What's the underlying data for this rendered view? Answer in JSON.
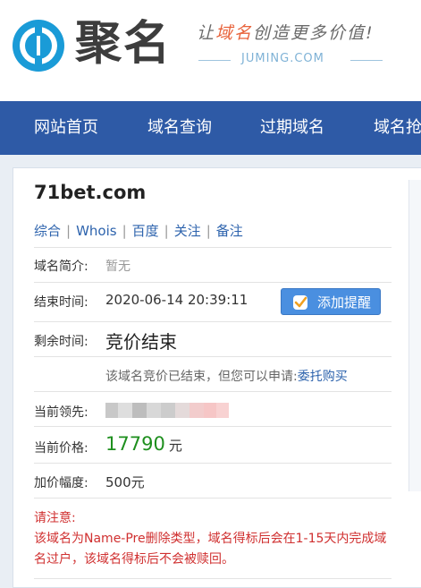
{
  "header": {
    "logo_text": "聚名",
    "slogan_prefix": "让",
    "slogan_highlight": "域名",
    "slogan_suffix": "创造更多价值!",
    "brand_domain": "JUMING.COM"
  },
  "nav": {
    "items": [
      "网站首页",
      "域名查询",
      "过期域名",
      "域名抢"
    ]
  },
  "detail": {
    "domain": "71bet.com",
    "links": [
      "综合",
      "Whois",
      "百度",
      "关注",
      "备注"
    ],
    "intro_label": "域名简介:",
    "intro_value": "暂无",
    "end_time_label": "结束时间:",
    "end_time_value": "2020-06-14 20:39:11",
    "remind_button": "添加提醒",
    "remaining_label": "剩余时间:",
    "remaining_value": "竞价结束",
    "ended_note": "该域名竞价已结束，但您可以申请:",
    "ended_link": "委托购买",
    "leader_label": "当前领先:",
    "price_label": "当前价格:",
    "price_value": "17790",
    "price_unit": "元",
    "increment_label": "加价幅度:",
    "increment_value": "500元",
    "warning_title": "请注意:",
    "warning_body": "该域名为Name-Pre删除类型，域名得标后会在1-15天内完成域名过户，该域名得标后不会被赎回。"
  },
  "colors": {
    "nav_bg": "#2e5aa6",
    "link": "#2d63ad",
    "price": "#1e8f1e",
    "warning": "#d03030",
    "button": "#4a8fe0"
  }
}
